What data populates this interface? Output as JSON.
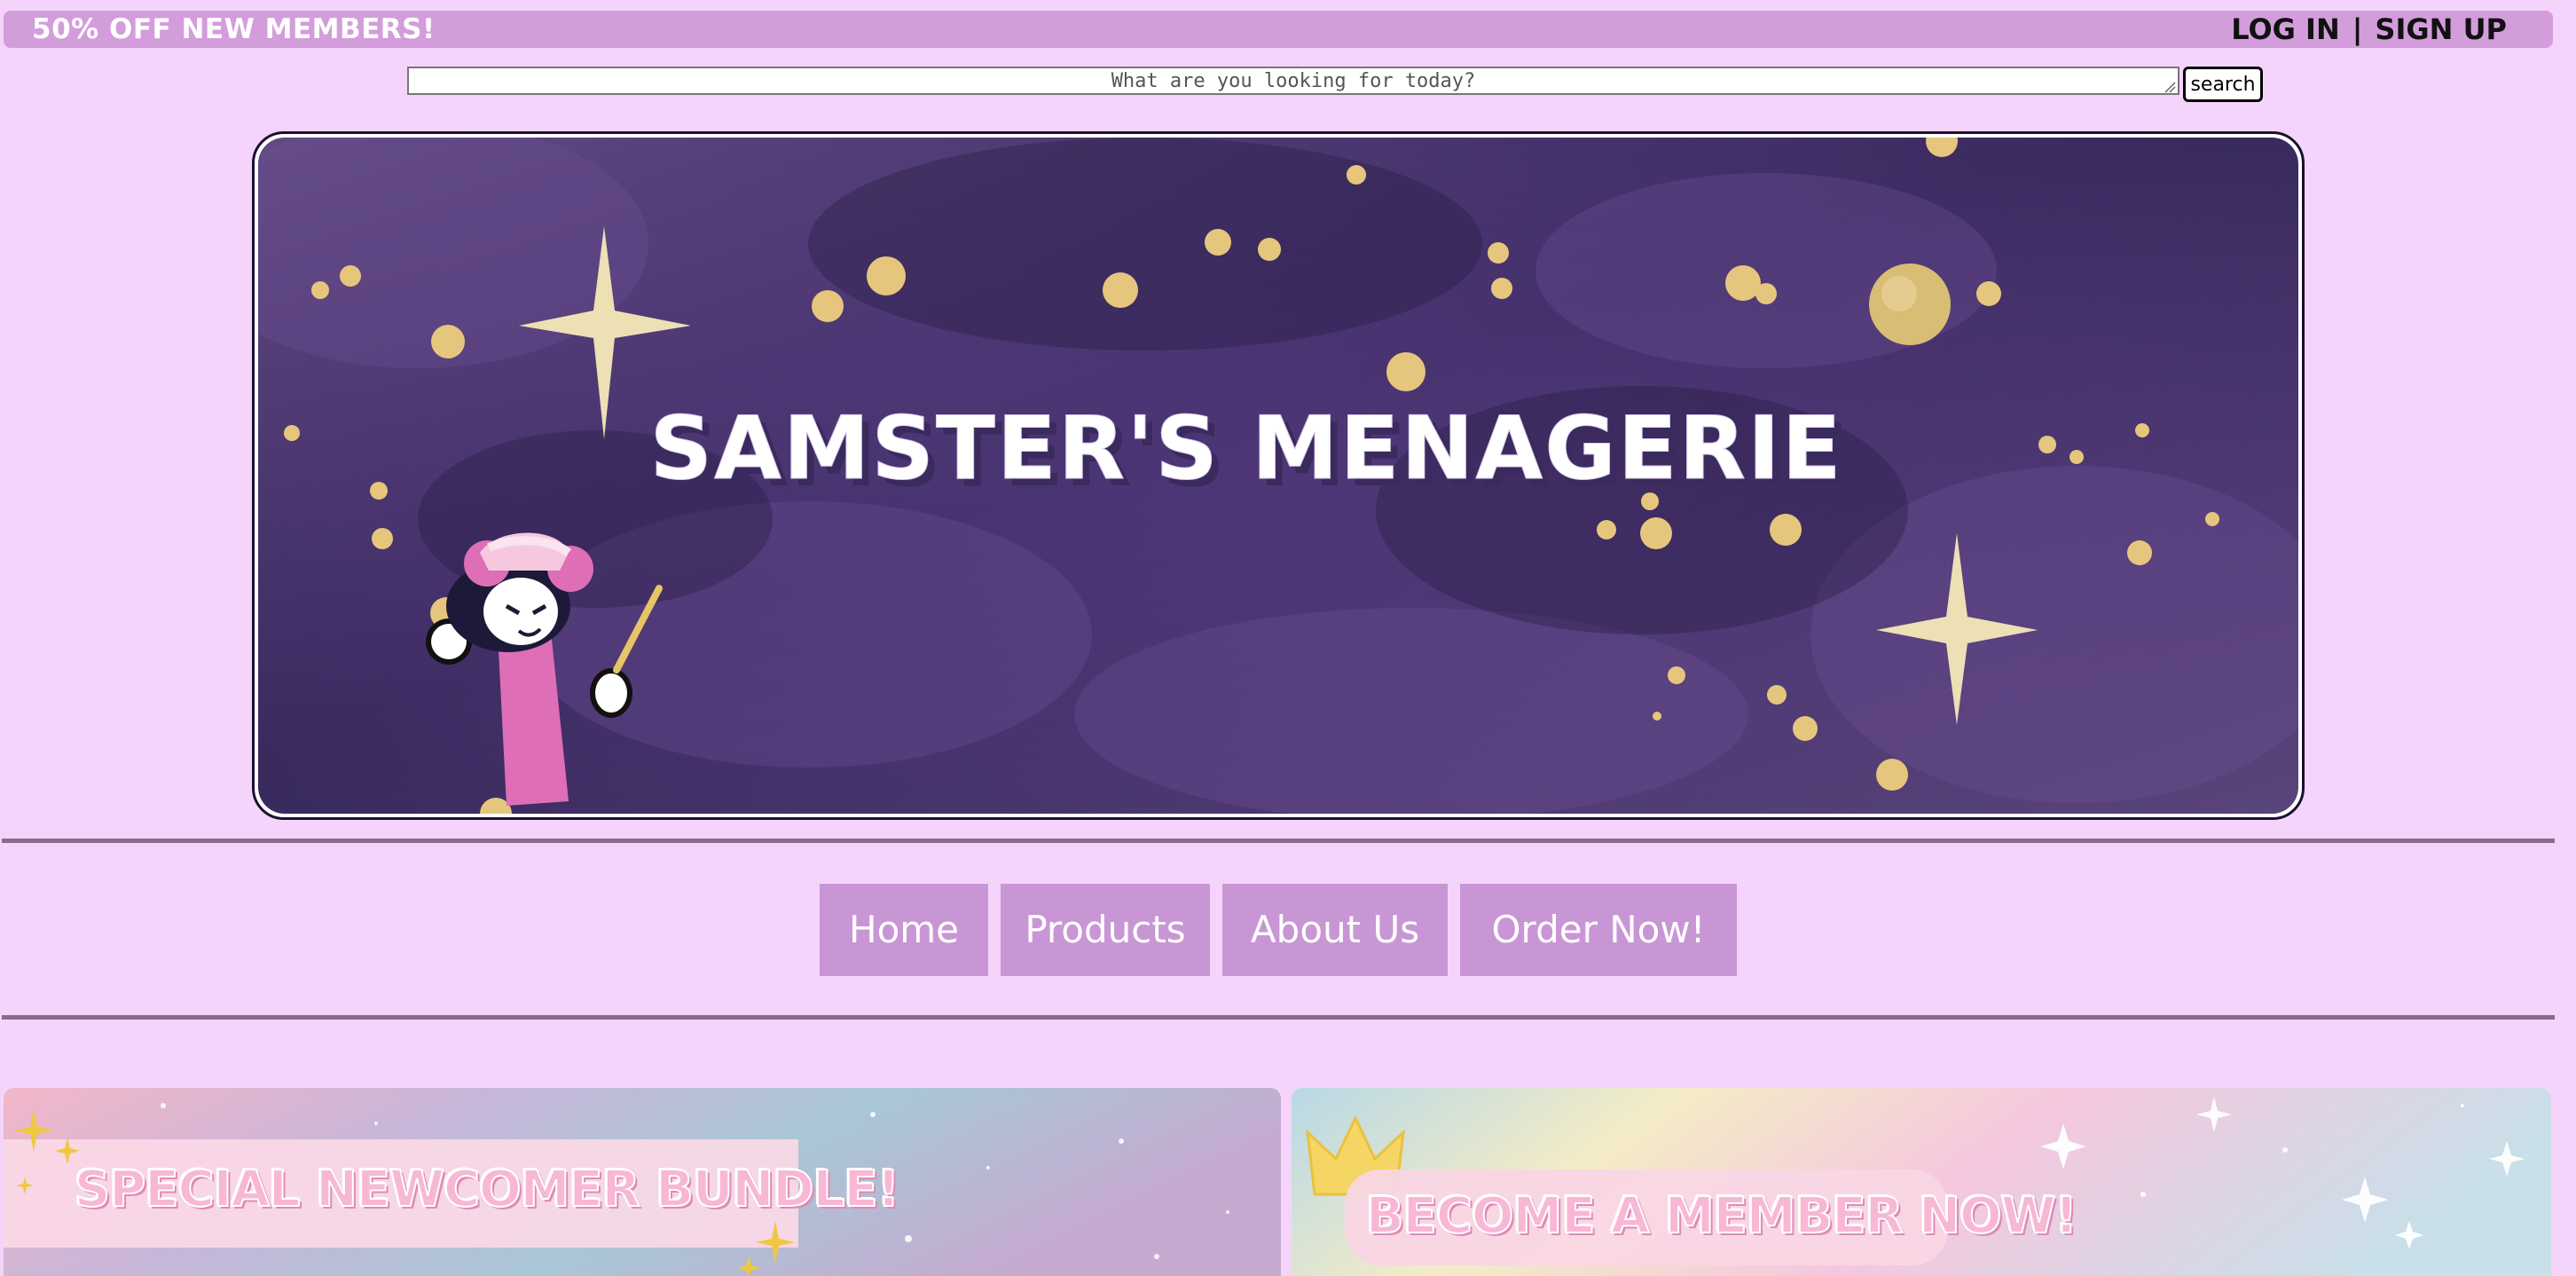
{
  "topbar": {
    "promo_text": "50% OFF NEW MEMBERS!",
    "login_label": "LOG IN",
    "separator": "|",
    "signup_label": "SIGN UP"
  },
  "search": {
    "placeholder": "What are you looking for today?",
    "value": "",
    "button_label": "search"
  },
  "banner": {
    "title": "SAMSTER'S MENAGERIE",
    "background_color": "#4a3470",
    "star_color": "#e9dcb0",
    "dot_color": "#e8c87a"
  },
  "nav": {
    "items": [
      {
        "label": "Home"
      },
      {
        "label": "Products"
      },
      {
        "label": "About Us"
      },
      {
        "label": "Order Now!"
      }
    ]
  },
  "cards": {
    "newcomer_bundle": "SPECIAL NEWCOMER BUNDLE!",
    "become_member": "BECOME A MEMBER NOW!"
  },
  "colors": {
    "page_bg": "#f5d4fb",
    "topbar_bg": "#d39ddb",
    "nav_bg": "#c996d5",
    "rule": "#8a6a8e"
  }
}
